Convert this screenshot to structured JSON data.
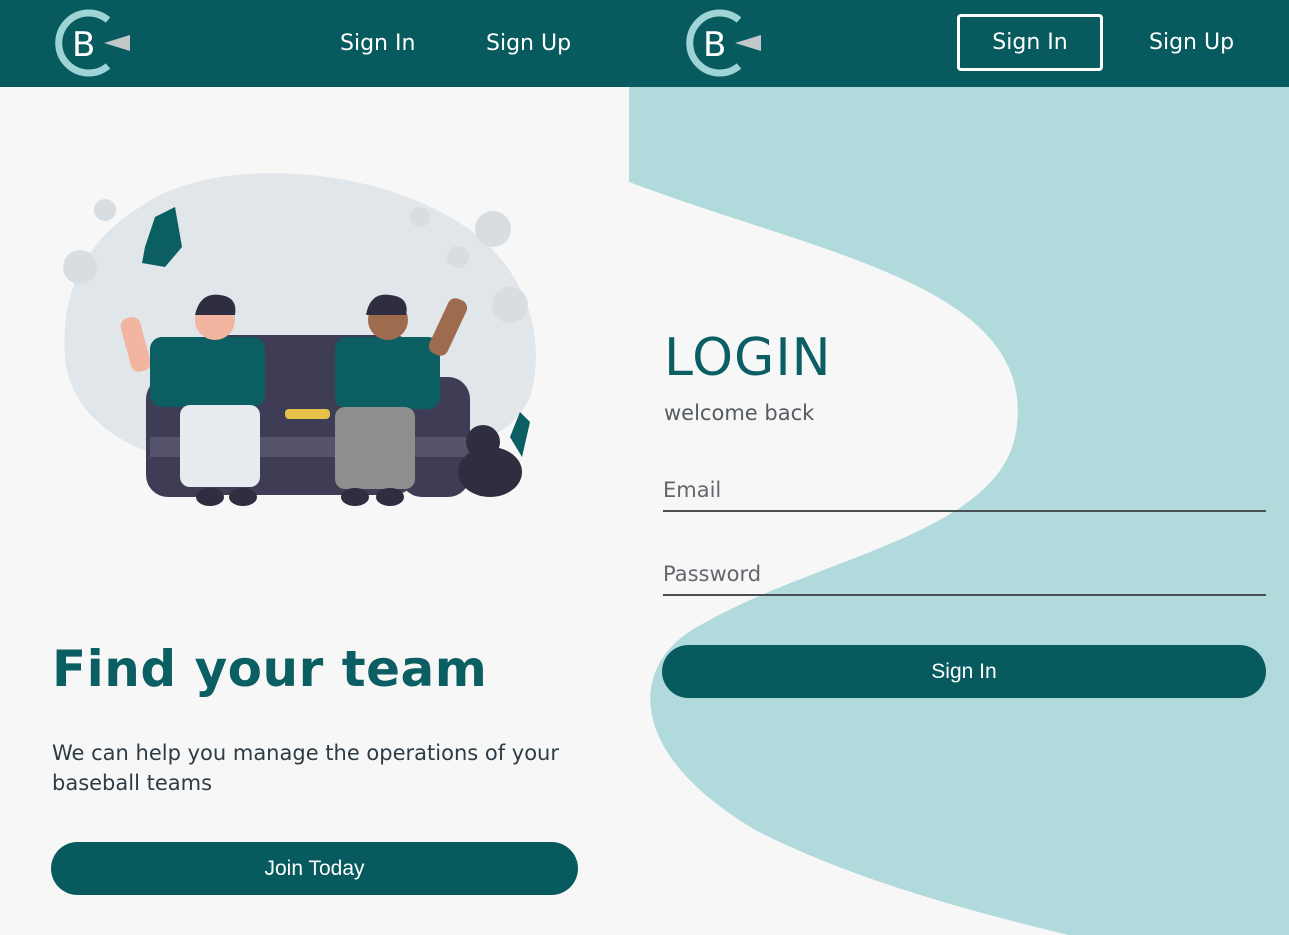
{
  "brand": {
    "logo_letter": "B"
  },
  "nav_left": {
    "sign_in": "Sign In",
    "sign_up": "Sign Up"
  },
  "nav_right": {
    "sign_in": "Sign In",
    "sign_up": "Sign Up"
  },
  "hero": {
    "title": "Find your team",
    "description": "We can help you manage the operations of your baseball teams",
    "cta": "Join Today"
  },
  "login": {
    "title": "LOGIN",
    "subtitle": "welcome back",
    "email_placeholder": "Email",
    "password_placeholder": "Password",
    "submit": "Sign In"
  },
  "colors": {
    "primary": "#075a5e",
    "accent_light": "#b0dadc",
    "background": "#f7f7f8"
  }
}
